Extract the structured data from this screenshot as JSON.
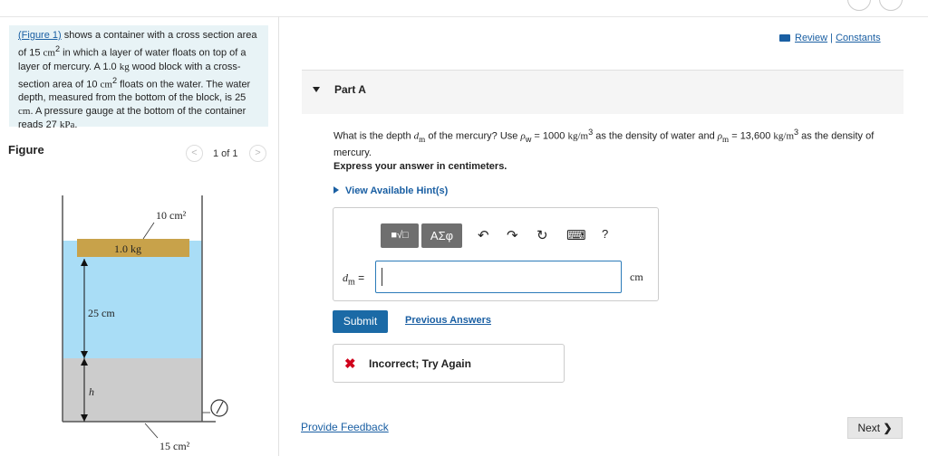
{
  "problem": {
    "fig_link": "(Figure 1)",
    "text_a": " shows a container with a cross section area of 15 ",
    "unit1": "cm",
    "text_b": " in which a layer of water floats on top of a layer of mercury. A 1.0 ",
    "unit_kg": "kg",
    "text_c": " wood block with a cross-section area of 10 ",
    "unit2": "cm",
    "text_d": " floats on the water. The water depth, measured from the bottom of the block, is 25 ",
    "unit_cm": "cm",
    "text_e": ". A pressure gauge at the bottom of the container reads 27 ",
    "unit_kpa": "kPa",
    "text_f": "."
  },
  "figure_panel": {
    "label": "Figure",
    "page_indicator": "1 of 1",
    "prev_glyph": "<",
    "next_glyph": ">"
  },
  "figure": {
    "top_area_label": "10 cm²",
    "block_label": "1.0 kg",
    "water_depth_label": "25 cm",
    "mercury_depth_label": "h",
    "bottom_area_label": "15 cm²",
    "colors": {
      "water": "#a9ddf6",
      "mercury": "#cccccc",
      "block": "#c8a24a",
      "wall": "#555555"
    }
  },
  "header": {
    "review": "Review",
    "divider": "|",
    "constants": "Constants"
  },
  "part": {
    "label": "Part A"
  },
  "question": {
    "t1": "What is the depth ",
    "v_dm": "d",
    "v_dm_sub": "m",
    "t2": " of the mercury? Use ",
    "v_rho": "ρ",
    "v_rho_w": "w",
    "t3": " = 1000 ",
    "u_density1": "kg/m",
    "t4": " as the density of water and ",
    "v_rho2": "ρ",
    "v_rho_m": "m",
    "t5": " = 13,600 ",
    "u_density2": "kg/m",
    "t6": " as the density of mercury.",
    "sup3": "3",
    "sup2": "2"
  },
  "instruction": "Express your answer in centimeters.",
  "hint": "View Available Hint(s)",
  "toolbar": {
    "templates_glyph": "■√□",
    "greek_glyph": "ΑΣφ",
    "undo_glyph": "↶",
    "redo_glyph": "↷",
    "reset_glyph": "↻",
    "keyboard_glyph": "⌨",
    "help_glyph": "?"
  },
  "answer": {
    "label_var": "d",
    "label_sub": "m",
    "label_eq": " =",
    "value": "",
    "unit": "cm"
  },
  "actions": {
    "submit": "Submit",
    "previous_answers": "Previous Answers"
  },
  "feedback": {
    "icon": "✖",
    "message": "Incorrect; Try Again"
  },
  "footer": {
    "provide_feedback": "Provide Feedback",
    "next": "Next",
    "next_glyph": "❯"
  }
}
